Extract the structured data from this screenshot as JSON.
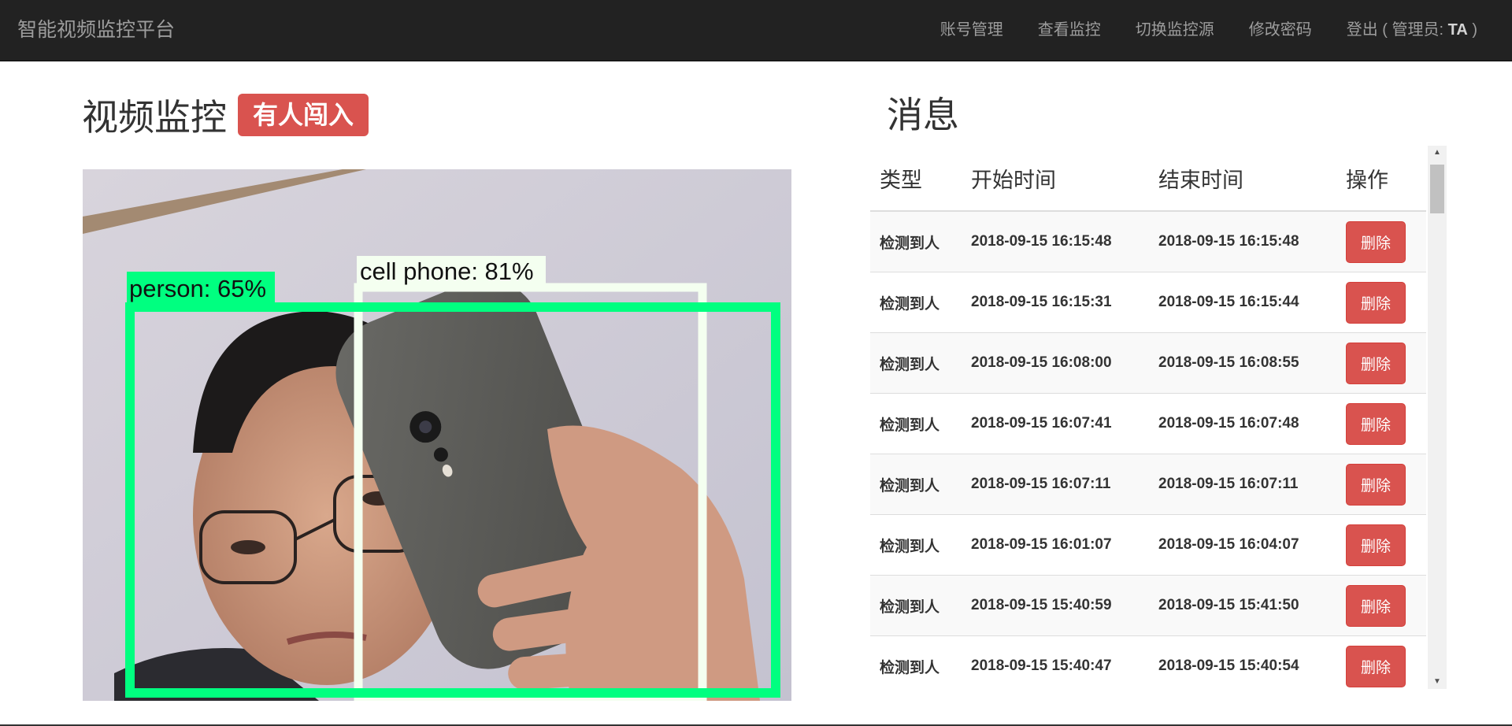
{
  "navbar": {
    "brand": "智能视频监控平台",
    "links": [
      {
        "label": "账号管理"
      },
      {
        "label": "查看监控"
      },
      {
        "label": "切换监控源"
      },
      {
        "label": "修改密码"
      }
    ],
    "logout_prefix": "登出 ( 管理员: ",
    "logout_user": "TA",
    "logout_suffix": " )"
  },
  "video_panel": {
    "title": "视频监控",
    "alert_badge": "有人闯入",
    "detections": [
      {
        "label": "person: 65%",
        "color": "#00ff80"
      },
      {
        "label": "cell phone: 81%",
        "color": "#f4fff0"
      }
    ]
  },
  "messages_panel": {
    "title": "消息",
    "columns": [
      "类型",
      "开始时间",
      "结束时间",
      "操作"
    ],
    "delete_label": "删除",
    "rows": [
      {
        "type": "检测到人",
        "start": "2018-09-15 16:15:48",
        "end": "2018-09-15 16:15:48"
      },
      {
        "type": "检测到人",
        "start": "2018-09-15 16:15:31",
        "end": "2018-09-15 16:15:44"
      },
      {
        "type": "检测到人",
        "start": "2018-09-15 16:08:00",
        "end": "2018-09-15 16:08:55"
      },
      {
        "type": "检测到人",
        "start": "2018-09-15 16:07:41",
        "end": "2018-09-15 16:07:48"
      },
      {
        "type": "检测到人",
        "start": "2018-09-15 16:07:11",
        "end": "2018-09-15 16:07:11"
      },
      {
        "type": "检测到人",
        "start": "2018-09-15 16:01:07",
        "end": "2018-09-15 16:04:07"
      },
      {
        "type": "检测到人",
        "start": "2018-09-15 15:40:59",
        "end": "2018-09-15 15:41:50"
      },
      {
        "type": "检测到人",
        "start": "2018-09-15 15:40:47",
        "end": "2018-09-15 15:40:54"
      }
    ]
  },
  "colors": {
    "navbar_bg": "#222222",
    "danger": "#d9534f",
    "person_box": "#00ff80",
    "phone_box": "#f4fff0"
  }
}
